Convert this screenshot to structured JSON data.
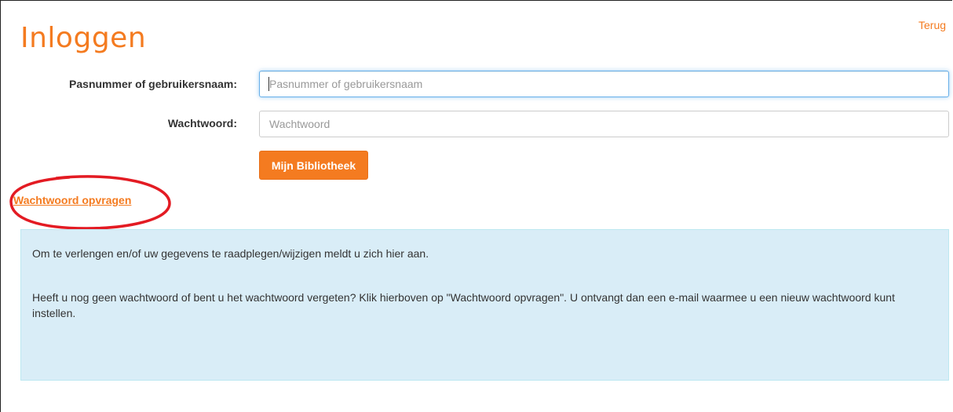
{
  "page": {
    "title": "Inloggen",
    "back_link": "Terug"
  },
  "form": {
    "username_label": "Pasnummer of gebruikersnaam:",
    "username_placeholder": "Pasnummer of gebruikersnaam",
    "username_value": "",
    "password_label": "Wachtwoord:",
    "password_placeholder": "Wachtwoord",
    "password_value": "",
    "submit_label": "Mijn Bibliotheek"
  },
  "reset_link": "Wachtwoord opvragen",
  "info": {
    "line1": "Om te verlengen en/of uw gegevens te raadplegen/wijzigen meldt u zich hier aan.",
    "line2": "Heeft u nog geen wachtwoord of bent u het wachtwoord vergeten? Klik hierboven op \"Wachtwoord opvragen\". U ontvangt dan een e-mail waarmee u een nieuw wachtwoord kunt instellen."
  },
  "colors": {
    "accent": "#f47b20",
    "info_background": "#d9edf7",
    "annotation": "#e31b23"
  }
}
